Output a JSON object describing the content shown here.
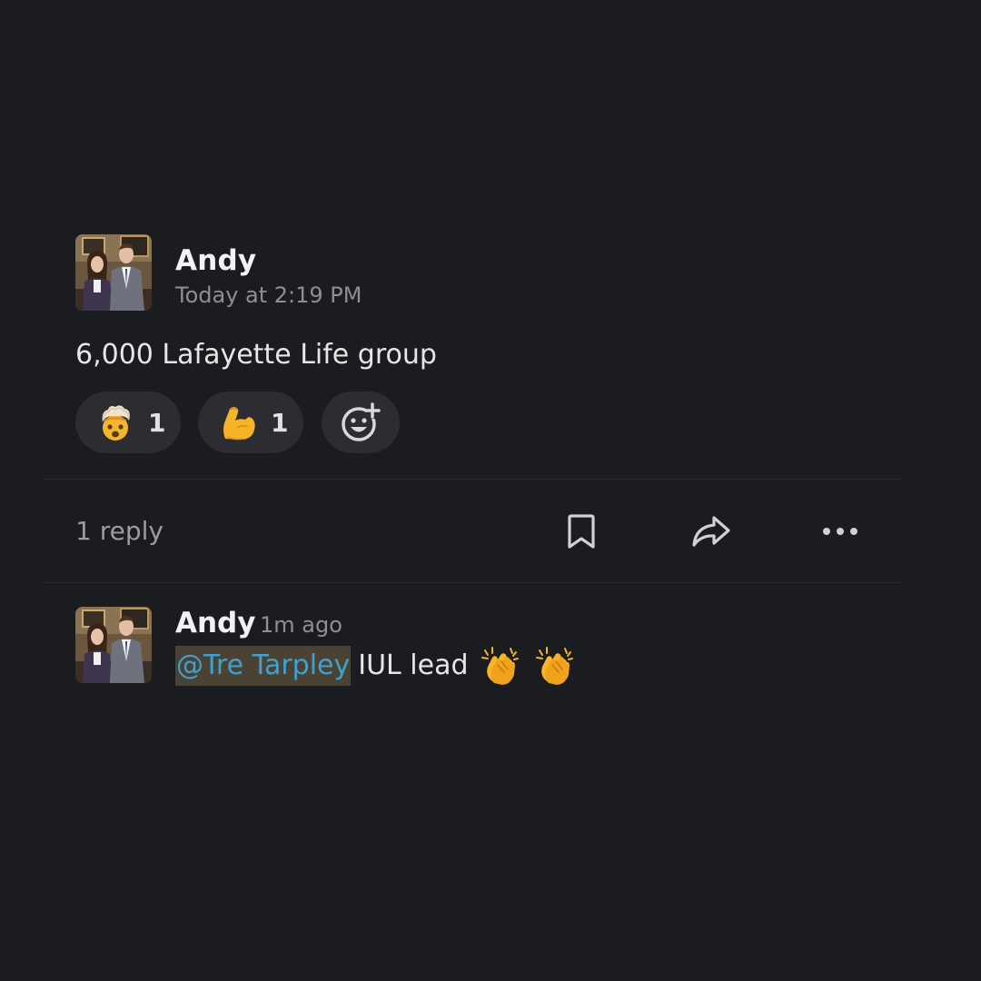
{
  "message": {
    "author": "Andy",
    "timestamp": "Today at 2:19 PM",
    "text": "6,000 Lafayette Life group",
    "reactions": [
      {
        "emoji": "exploding-head-emoji",
        "count": "1"
      },
      {
        "emoji": "flexed-biceps-emoji",
        "count": "1"
      }
    ],
    "add_reaction_icon": "add-reaction-icon"
  },
  "thread": {
    "reply_count": "1 reply",
    "actions": [
      "bookmark-icon",
      "forward-icon",
      "more-icon"
    ]
  },
  "reply": {
    "author": "Andy",
    "time": "1m ago",
    "mention": "@Tre Tarpley",
    "text": "IUL lead",
    "emojis": [
      "clapping-hands-emoji",
      "clapping-hands-emoji"
    ]
  },
  "colors": {
    "background": "#1b1c20",
    "pill": "#2c2d32",
    "mention_text": "#3fa0d2",
    "mention_bg": "#4a4232",
    "muted": "#8d8f94"
  }
}
